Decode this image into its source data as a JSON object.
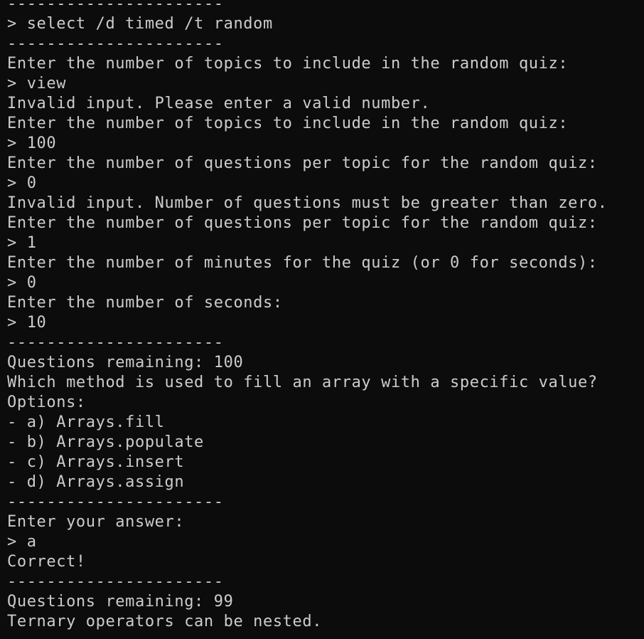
{
  "terminal": {
    "lines": [
      "----------------------",
      "> select /d timed /t random",
      "----------------------",
      "Enter the number of topics to include in the random quiz:",
      "> view",
      "Invalid input. Please enter a valid number.",
      "Enter the number of topics to include in the random quiz:",
      "> 100",
      "Enter the number of questions per topic for the random quiz:",
      "> 0",
      "Invalid input. Number of questions must be greater than zero.",
      "Enter the number of questions per topic for the random quiz:",
      "> 1",
      "Enter the number of minutes for the quiz (or 0 for seconds):",
      "> 0",
      "Enter the number of seconds:",
      "> 10",
      "----------------------",
      "Questions remaining: 100",
      "Which method is used to fill an array with a specific value?",
      "Options:",
      "- a) Arrays.fill",
      "- b) Arrays.populate",
      "- c) Arrays.insert",
      "- d) Arrays.assign",
      "----------------------",
      "Enter your answer:",
      "> a",
      "Correct!",
      "----------------------",
      "Questions remaining: 99",
      "Ternary operators can be nested."
    ]
  },
  "colors": {
    "background": "#0c0c0c",
    "foreground": "#cccccc"
  }
}
